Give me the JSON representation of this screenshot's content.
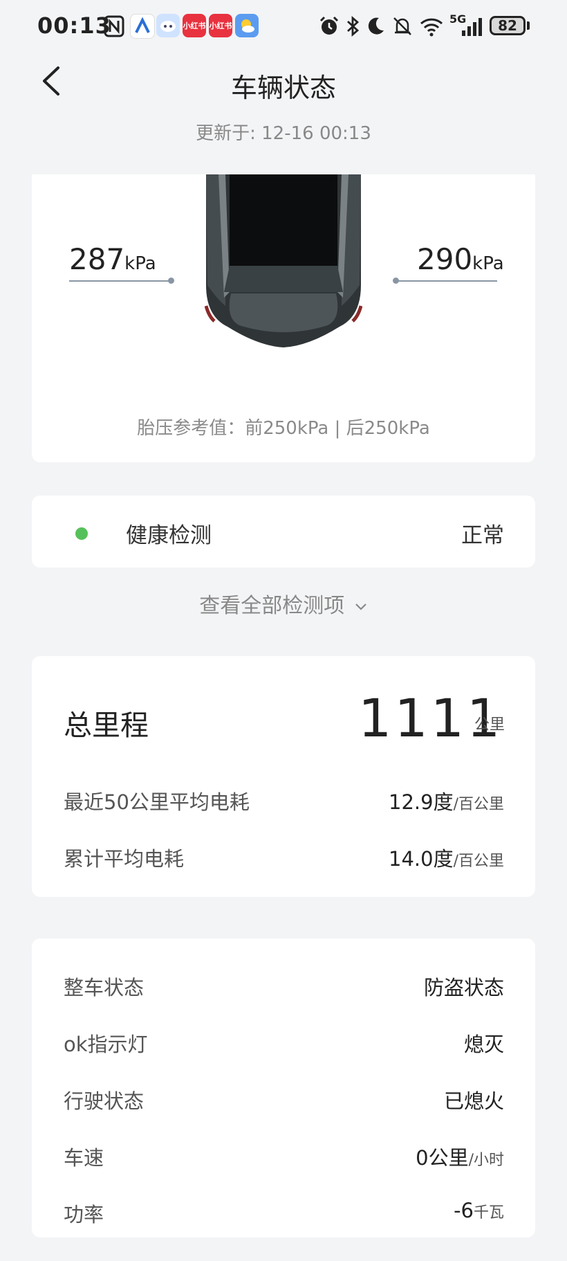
{
  "status_bar": {
    "time": "00:13",
    "apps": [
      "小红书",
      "小红书"
    ],
    "battery": "82",
    "network": "5G"
  },
  "header": {
    "title": "车辆状态",
    "updated": "更新于: 12-16 00:13"
  },
  "tires": {
    "left_value": "287",
    "right_value": "290",
    "unit": "kPa",
    "reference": "胎压参考值：前250kPa | 后250kPa"
  },
  "health": {
    "label": "健康检测",
    "value": "正常",
    "status_color": "#56c15a",
    "view_all": "查看全部检测项"
  },
  "mileage": {
    "total_label": "总里程",
    "total_value": "1111",
    "total_unit": "公里",
    "rows": [
      {
        "label": "最近50公里平均电耗",
        "value": "12.9度",
        "unit": "/百公里"
      },
      {
        "label": "累计平均电耗",
        "value": "14.0度",
        "unit": "/百公里"
      }
    ]
  },
  "vehicle_status": [
    {
      "label": "整车状态",
      "value": "防盗状态",
      "unit": ""
    },
    {
      "label": "ok指示灯",
      "value": "熄灭",
      "unit": ""
    },
    {
      "label": "行驶状态",
      "value": "已熄火",
      "unit": ""
    },
    {
      "label": "车速",
      "value": "0公里",
      "unit": "/小时"
    },
    {
      "label": "功率",
      "value": "-6",
      "unit": "千瓦"
    }
  ]
}
